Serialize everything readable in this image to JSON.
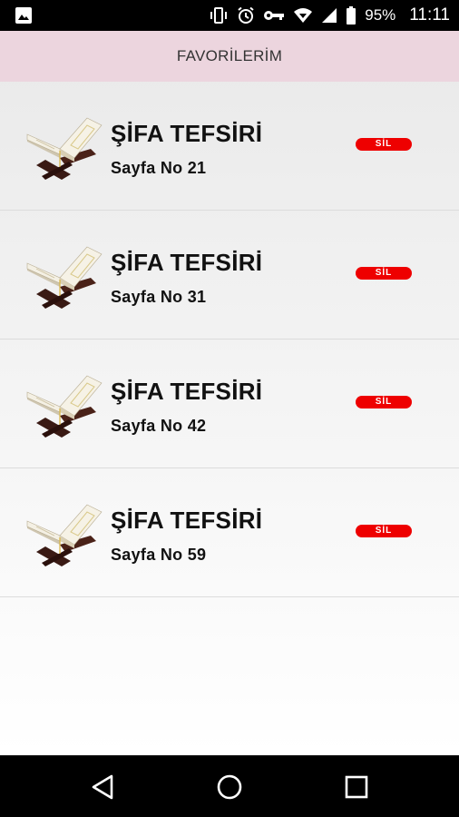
{
  "status_bar": {
    "battery_percent": "95%",
    "time": "11:11",
    "icons": [
      "image-icon",
      "vibrate-icon",
      "alarm-icon",
      "key-icon",
      "wifi-icon",
      "signal-icon",
      "battery-icon"
    ]
  },
  "header": {
    "title": "FAVORİLERİM",
    "background_color": "#ecd5de"
  },
  "favorites": [
    {
      "title": "ŞİFA TEFSİRİ",
      "page_label": "Sayfa No 21",
      "delete_label": "SİL"
    },
    {
      "title": "ŞİFA TEFSİRİ",
      "page_label": "Sayfa No 31",
      "delete_label": "SİL"
    },
    {
      "title": "ŞİFA TEFSİRİ",
      "page_label": "Sayfa No 42",
      "delete_label": "SİL"
    },
    {
      "title": "ŞİFA TEFSİRİ",
      "page_label": "Sayfa No 59",
      "delete_label": "SİL"
    }
  ],
  "colors": {
    "delete_button": "#ee0000",
    "text": "#111111"
  },
  "nav_bar": {
    "icons": [
      "back-icon",
      "home-icon",
      "recents-icon"
    ]
  }
}
